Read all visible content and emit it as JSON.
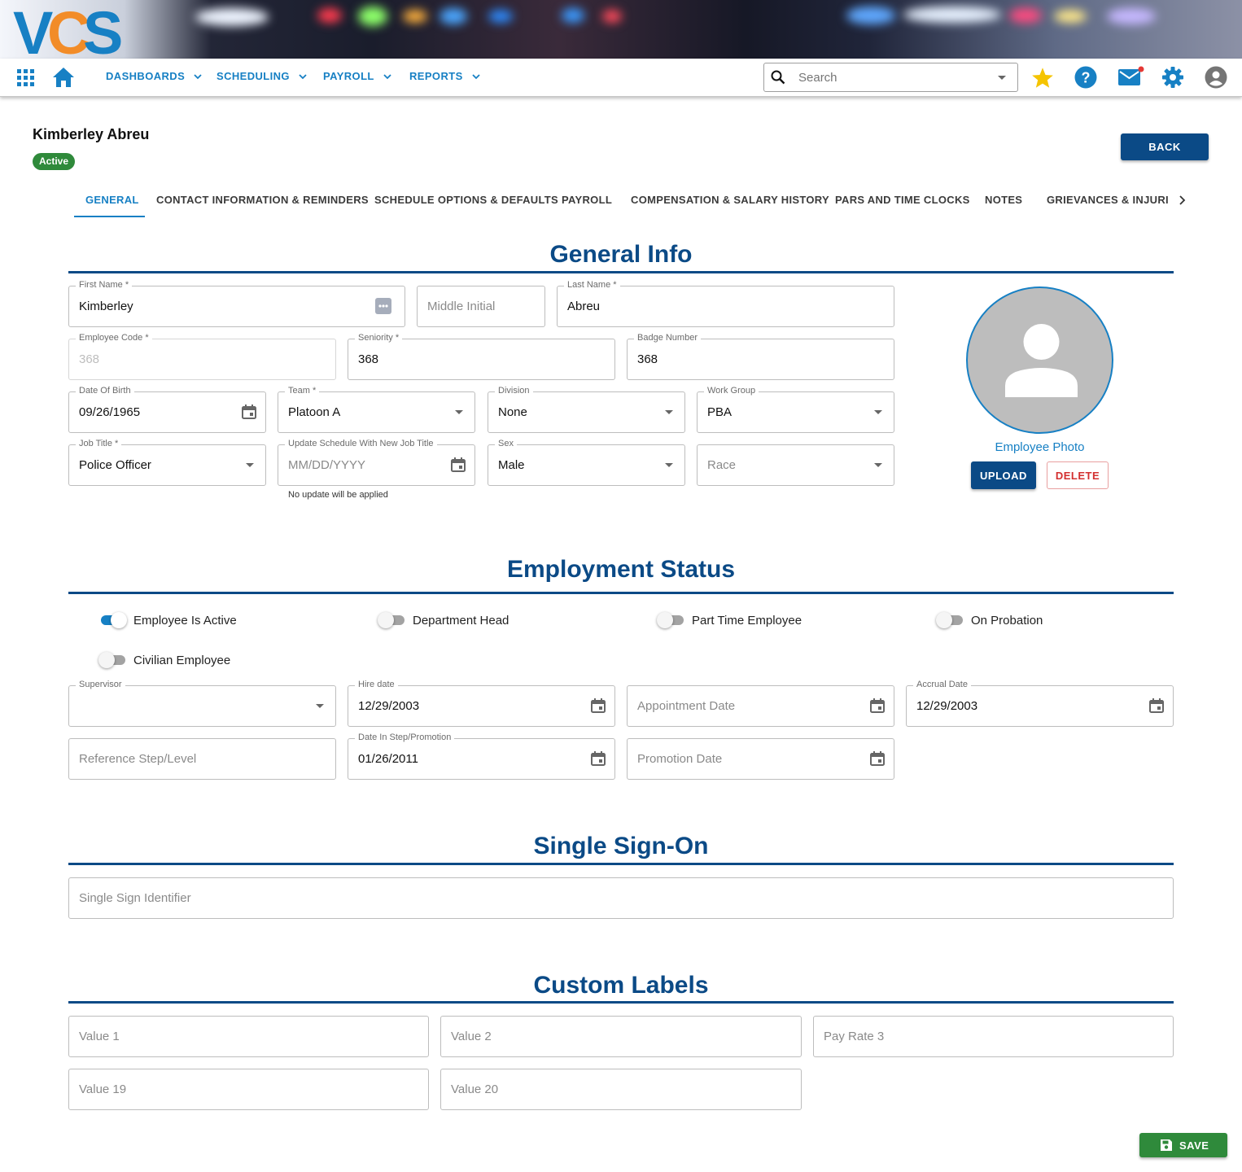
{
  "app": {
    "logo_text": "VCS"
  },
  "nav": {
    "menus": [
      {
        "label": "DASHBOARDS"
      },
      {
        "label": "SCHEDULING"
      },
      {
        "label": "PAYROLL"
      },
      {
        "label": "REPORTS"
      }
    ],
    "search": {
      "placeholder": "Search",
      "value": ""
    },
    "icons": [
      "apps-grid-icon",
      "home-icon",
      "star-icon",
      "help-icon",
      "mail-icon",
      "settings-gear-icon",
      "account-icon"
    ],
    "mail_has_notification": true
  },
  "colors": {
    "primary": "#0b4a86",
    "accent": "#1780c4",
    "success": "#2f8a3b",
    "danger": "#d32f2f",
    "star": "#f5c400"
  },
  "header": {
    "employee_name": "Kimberley Abreu",
    "status": "Active",
    "back_label": "BACK"
  },
  "tabs": [
    {
      "label": "GENERAL",
      "active": true
    },
    {
      "label": "CONTACT INFORMATION & REMINDERS"
    },
    {
      "label": "SCHEDULE OPTIONS & DEFAULTS"
    },
    {
      "label": "PAYROLL"
    },
    {
      "label": "COMPENSATION & SALARY HISTORY"
    },
    {
      "label": "PARS AND TIME CLOCKS"
    },
    {
      "label": "NOTES"
    },
    {
      "label": "GRIEVANCES & INJURIES"
    }
  ],
  "general": {
    "title": "General Info",
    "first_name": {
      "label": "First Name *",
      "value": "Kimberley"
    },
    "middle_initial": {
      "placeholder": "Middle Initial"
    },
    "last_name": {
      "label": "Last Name *",
      "value": "Abreu"
    },
    "employee_code": {
      "label": "Employee Code *",
      "value": "368"
    },
    "seniority": {
      "label": "Seniority *",
      "value": "368"
    },
    "badge_number": {
      "label": "Badge Number",
      "value": "368"
    },
    "dob": {
      "label": "Date Of Birth",
      "value": "09/26/1965"
    },
    "team": {
      "label": "Team *",
      "value": "Platoon A"
    },
    "division": {
      "label": "Division",
      "value": "None"
    },
    "work_group": {
      "label": "Work Group",
      "value": "PBA"
    },
    "job_title": {
      "label": "Job Title *",
      "value": "Police Officer"
    },
    "update_schedule": {
      "label": "Update Schedule With New Job Title",
      "placeholder": "MM/DD/YYYY",
      "helper": "No update will be applied"
    },
    "sex": {
      "label": "Sex",
      "value": "Male"
    },
    "race": {
      "placeholder": "Race"
    },
    "photo": {
      "label": "Employee Photo",
      "upload_label": "UPLOAD",
      "delete_label": "DELETE"
    }
  },
  "employment": {
    "title": "Employment Status",
    "toggles": [
      {
        "label": "Employee Is Active",
        "on": true
      },
      {
        "label": "Department Head",
        "on": false
      },
      {
        "label": "Part Time Employee",
        "on": false
      },
      {
        "label": "On Probation",
        "on": false
      },
      {
        "label": "Civilian Employee",
        "on": false
      }
    ],
    "supervisor": {
      "label": "Supervisor",
      "value": ""
    },
    "hire_date": {
      "label": "Hire date",
      "value": "12/29/2003"
    },
    "appointment_date": {
      "placeholder": "Appointment Date"
    },
    "accrual_date": {
      "label": "Accrual Date",
      "value": "12/29/2003"
    },
    "reference_step": {
      "placeholder": "Reference Step/Level"
    },
    "date_in_step": {
      "label": "Date In Step/Promotion",
      "value": "01/26/2011"
    },
    "promotion_date": {
      "placeholder": "Promotion Date"
    }
  },
  "sso": {
    "title": "Single Sign-On",
    "identifier": {
      "placeholder": "Single Sign Identifier"
    }
  },
  "custom": {
    "title": "Custom Labels",
    "fields": [
      {
        "placeholder": "Value 1"
      },
      {
        "placeholder": "Value 2"
      },
      {
        "placeholder": "Pay Rate 3"
      },
      {
        "placeholder": "Value 19"
      },
      {
        "placeholder": "Value 20"
      }
    ]
  },
  "footer": {
    "save_label": "SAVE"
  }
}
